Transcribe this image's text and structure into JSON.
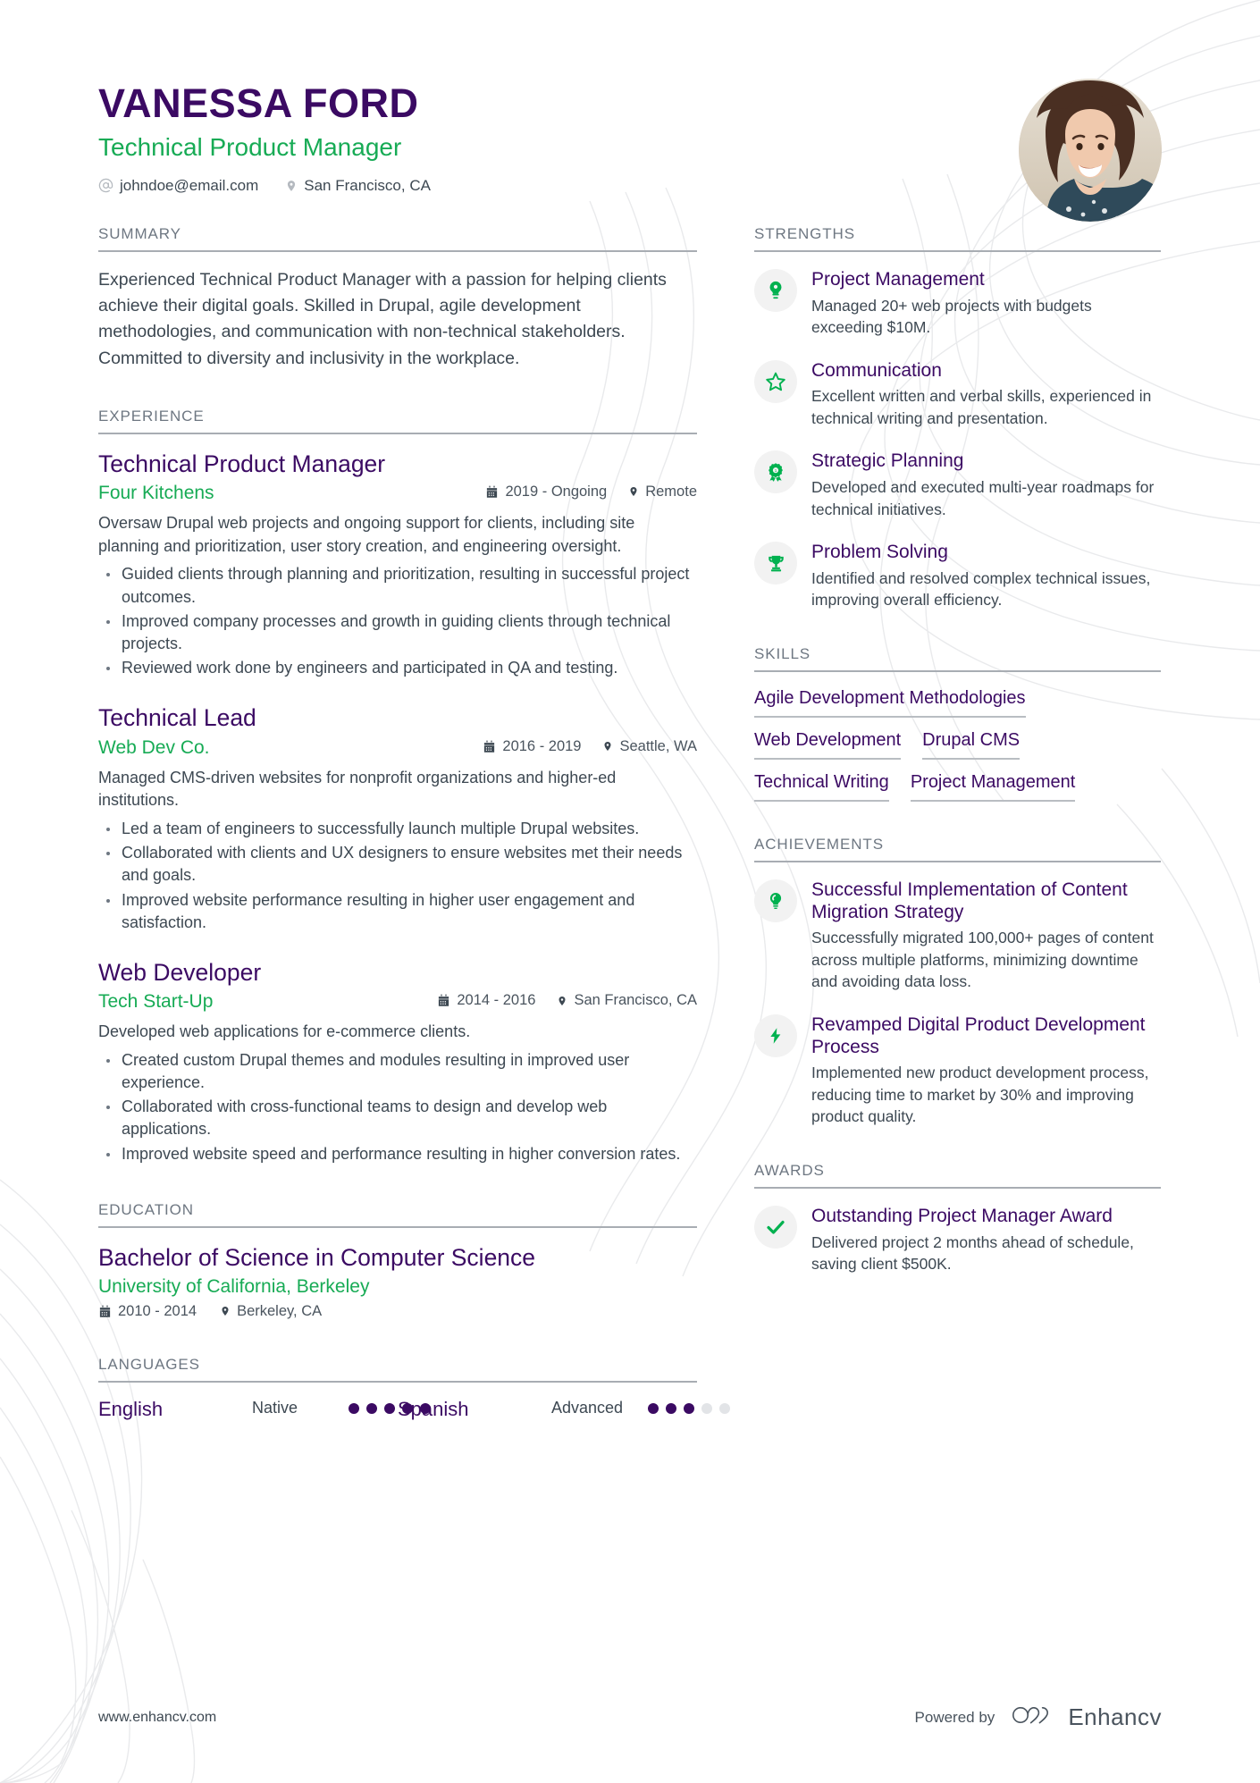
{
  "header": {
    "name": "VANESSA FORD",
    "role": "Technical Product Manager",
    "email": "johndoe@email.com",
    "location": "San Francisco, CA"
  },
  "summary": {
    "title": "SUMMARY",
    "text": "Experienced Technical Product Manager with a passion for helping clients achieve their digital goals. Skilled in Drupal, agile development methodologies, and communication with non-technical stakeholders. Committed to diversity and inclusivity in the workplace."
  },
  "experience": {
    "title": "EXPERIENCE",
    "entries": [
      {
        "role": "Technical Product Manager",
        "company": "Four Kitchens",
        "dates": "2019 - Ongoing",
        "location": "Remote",
        "description": "Oversaw Drupal web projects and ongoing support for clients, including site planning and prioritization, user story creation, and engineering oversight.",
        "bullets": [
          "Guided clients through planning and prioritization, resulting in successful project outcomes.",
          "Improved company processes and growth in guiding clients through technical projects.",
          "Reviewed work done by engineers and participated in QA and testing."
        ]
      },
      {
        "role": "Technical Lead",
        "company": "Web Dev Co.",
        "dates": "2016 - 2019",
        "location": "Seattle, WA",
        "description": "Managed CMS-driven websites for nonprofit organizations and higher-ed institutions.",
        "bullets": [
          "Led a team of engineers to successfully launch multiple Drupal websites.",
          "Collaborated with clients and UX designers to ensure websites met their needs and goals.",
          "Improved website performance resulting in higher user engagement and satisfaction."
        ]
      },
      {
        "role": "Web Developer",
        "company": "Tech Start-Up",
        "dates": "2014 - 2016",
        "location": "San Francisco, CA",
        "description": "Developed web applications for e-commerce clients.",
        "bullets": [
          "Created custom Drupal themes and modules resulting in improved user experience.",
          "Collaborated with cross-functional teams to design and develop web applications.",
          "Improved website speed and performance resulting in higher conversion rates."
        ]
      }
    ]
  },
  "education": {
    "title": "EDUCATION",
    "entries": [
      {
        "degree": "Bachelor of Science in Computer Science",
        "school": "University of California, Berkeley",
        "dates": "2010 - 2014",
        "location": "Berkeley, CA"
      }
    ]
  },
  "languages": {
    "title": "LANGUAGES",
    "items": [
      {
        "name": "English",
        "level": "Native",
        "filled": 5,
        "total": 5
      },
      {
        "name": "Spanish",
        "level": "Advanced",
        "filled": 3,
        "total": 5
      }
    ]
  },
  "strengths": {
    "title": "STRENGTHS",
    "items": [
      {
        "icon": "lightbulb-icon",
        "title": "Project Management",
        "desc": "Managed 20+ web projects with budgets exceeding $10M."
      },
      {
        "icon": "star-icon",
        "title": "Communication",
        "desc": "Excellent written and verbal skills, experienced in technical writing and presentation."
      },
      {
        "icon": "award-medal-icon",
        "title": "Strategic Planning",
        "desc": "Developed and executed multi-year roadmaps for technical initiatives."
      },
      {
        "icon": "trophy-icon",
        "title": "Problem Solving",
        "desc": "Identified and resolved complex technical issues, improving overall efficiency."
      }
    ]
  },
  "skills": {
    "title": "SKILLS",
    "items": [
      "Agile Development Methodologies",
      "Web Development",
      "Drupal CMS",
      "Technical Writing",
      "Project Management"
    ]
  },
  "achievements": {
    "title": "ACHIEVEMENTS",
    "items": [
      {
        "icon": "lightbulb-filled-icon",
        "title": "Successful Implementation of Content Migration Strategy",
        "desc": "Successfully migrated 100,000+ pages of content across multiple platforms, minimizing downtime and avoiding data loss."
      },
      {
        "icon": "lightning-bolt-icon",
        "title": "Revamped Digital Product Development Process",
        "desc": "Implemented new product development process, reducing time to market by 30% and improving product quality."
      }
    ]
  },
  "awards": {
    "title": "AWARDS",
    "items": [
      {
        "icon": "check-icon",
        "title": "Outstanding Project Manager Award",
        "desc": "Delivered project 2 months ahead of schedule, saving client $500K."
      }
    ]
  },
  "footer": {
    "url": "www.enhancv.com",
    "powered_by": "Powered by",
    "brand": "Enhancv"
  },
  "colors": {
    "purple": "#3b0a63",
    "green": "#17ab55",
    "text": "#3d4852",
    "muted": "#6e7782",
    "rule": "#a8adb3"
  }
}
